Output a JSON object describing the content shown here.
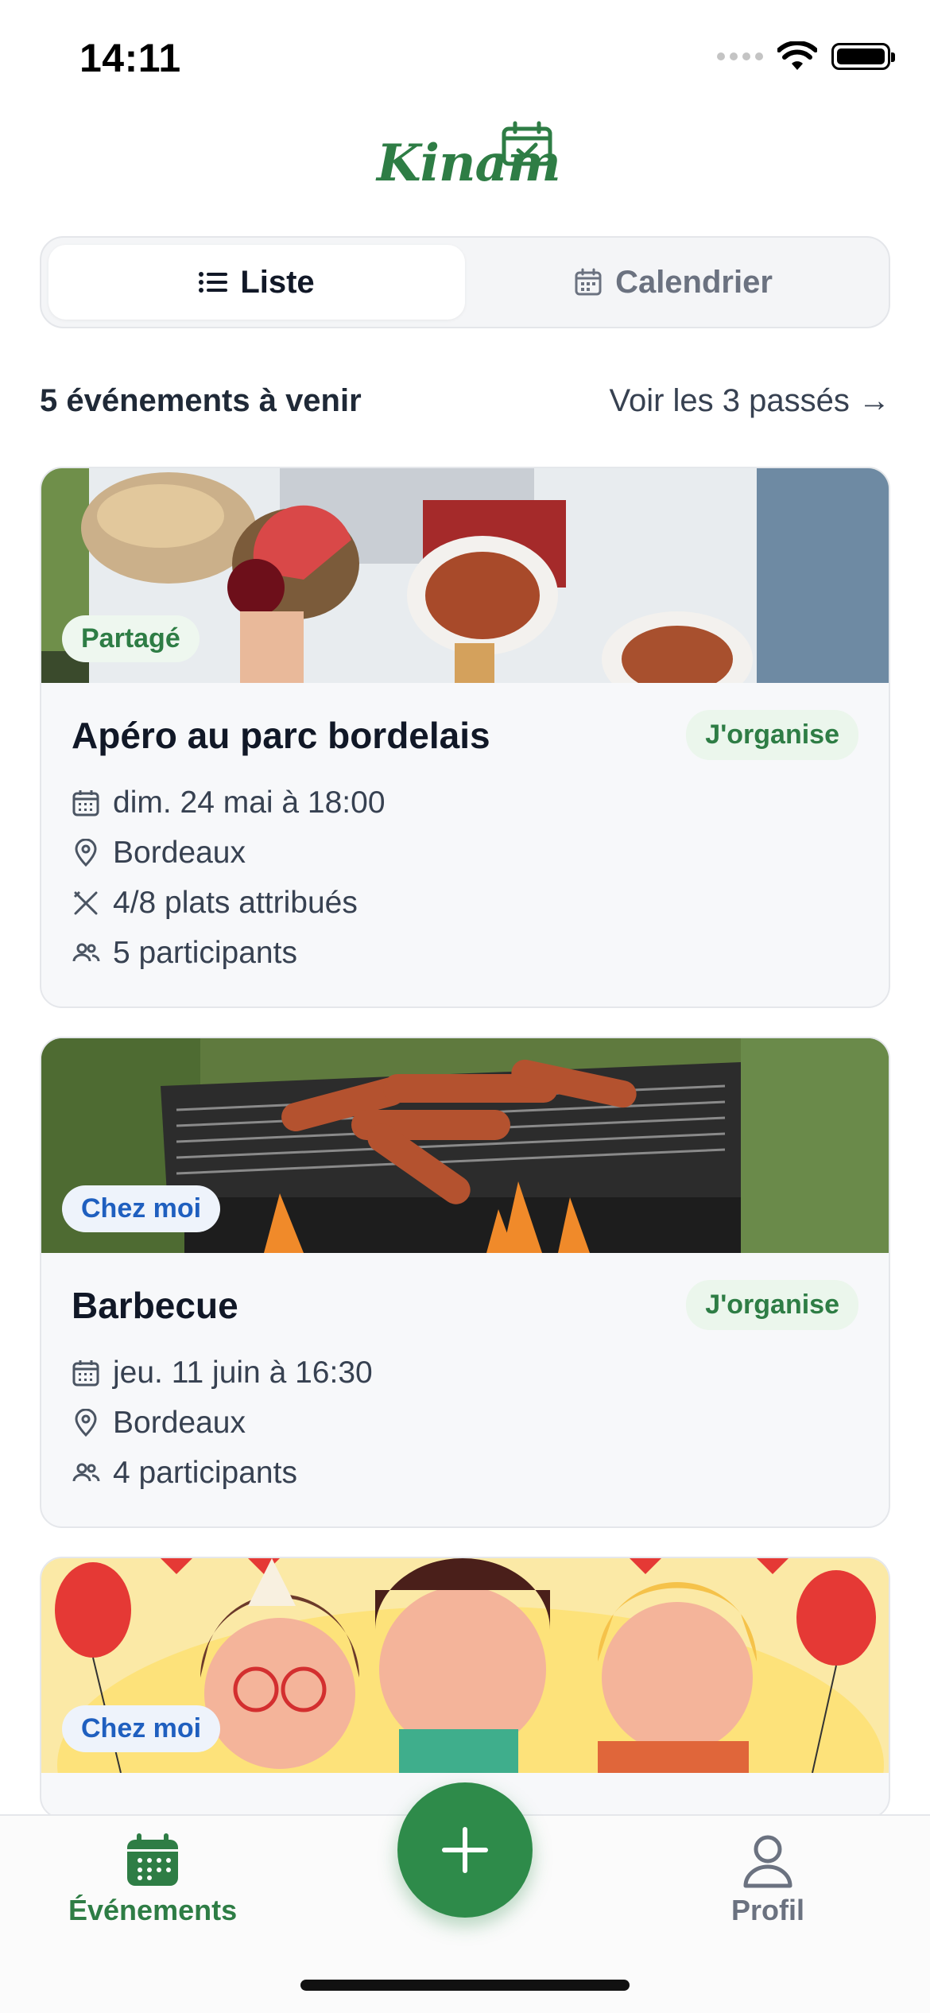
{
  "status": {
    "time": "14:11"
  },
  "app": {
    "logo_text": "Kinam"
  },
  "view_toggle": {
    "list_label": "Liste",
    "calendar_label": "Calendrier"
  },
  "section": {
    "upcoming_label": "5 événements à venir",
    "past_link": "Voir les 3 passés →"
  },
  "events": [
    {
      "chip": "Partagé",
      "title": "Apéro au parc bordelais",
      "badge": "J'organise",
      "date": "dim. 24 mai à 18:00",
      "location": "Bordeaux",
      "dishes": "4/8 plats attribués",
      "participants": "5 participants"
    },
    {
      "chip": "Chez moi",
      "title": "Barbecue",
      "badge": "J'organise",
      "date": "jeu. 11 juin à 16:30",
      "location": "Bordeaux",
      "participants": "4 participants"
    },
    {
      "chip": "Chez moi"
    }
  ],
  "nav": {
    "events_label": "Événements",
    "profile_label": "Profil"
  },
  "colors": {
    "brand_green": "#2e7d45",
    "blue_chip": "#1f5fbf",
    "fab": "#2e8b4a"
  },
  "icons": [
    "wifi-icon",
    "battery-icon",
    "list-icon",
    "calendar-icon",
    "location-pin-icon",
    "utensils-icon",
    "users-icon",
    "plus-icon",
    "user-icon"
  ]
}
